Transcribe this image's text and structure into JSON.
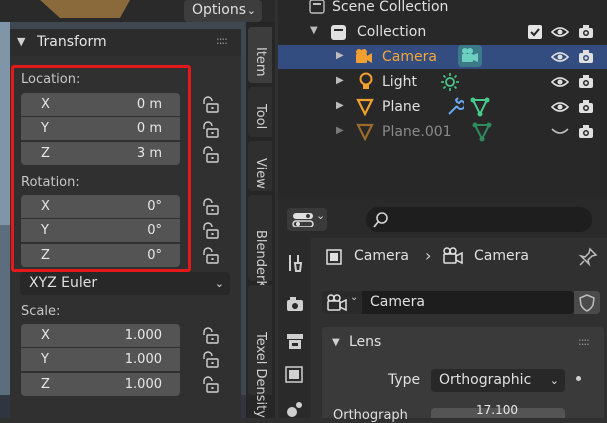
{
  "viewport": {
    "options_label": "Options"
  },
  "transform_panel": {
    "title": "Transform",
    "location_label": "Location:",
    "location": [
      {
        "axis": "X",
        "value": "0 m"
      },
      {
        "axis": "Y",
        "value": "0 m"
      },
      {
        "axis": "Z",
        "value": "3 m"
      }
    ],
    "rotation_label": "Rotation:",
    "rotation": [
      {
        "axis": "X",
        "value": "0°"
      },
      {
        "axis": "Y",
        "value": "0°"
      },
      {
        "axis": "Z",
        "value": "0°"
      }
    ],
    "rotation_mode": "XYZ Euler",
    "scale_label": "Scale:",
    "scale": [
      {
        "axis": "X",
        "value": "1.000"
      },
      {
        "axis": "Y",
        "value": "1.000"
      },
      {
        "axis": "Z",
        "value": "1.000"
      }
    ]
  },
  "side_tabs": [
    "Item",
    "Tool",
    "View",
    "BlenderKit",
    "Texel Density"
  ],
  "outliner": {
    "scene_collection": "Scene Collection",
    "collection": "Collection",
    "objects": [
      {
        "name": "Camera",
        "selected": true
      },
      {
        "name": "Light",
        "selected": false
      },
      {
        "name": "Plane",
        "selected": false
      },
      {
        "name": "Plane.001",
        "selected": false,
        "hidden": true
      }
    ]
  },
  "properties": {
    "breadcrumb_object": "Camera",
    "breadcrumb_data": "Camera",
    "data_name": "Camera",
    "lens_title": "Lens",
    "type_label": "Type",
    "type_value": "Orthographic",
    "ortho_label": "Orthograph",
    "ortho_value": "17.100"
  },
  "colors": {
    "accent_orange": "#f0a030",
    "selection": "#334d80",
    "highlight_box": "#e3191c",
    "camera_data_green": "#6bd0c0"
  }
}
